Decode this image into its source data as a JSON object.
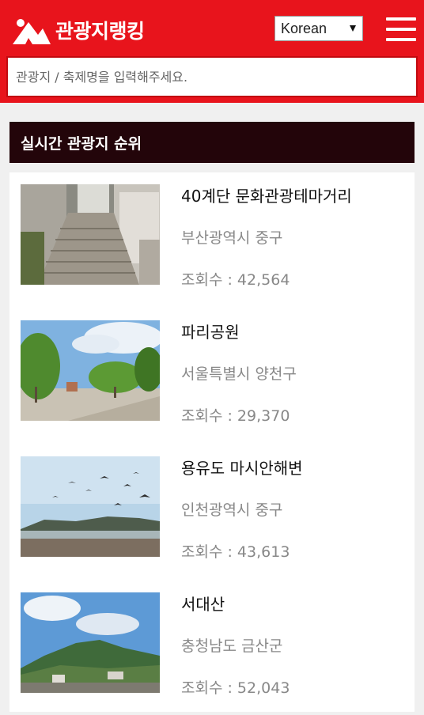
{
  "header": {
    "site_title": "관광지랭킹",
    "language": "Korean",
    "brand_color": "#e8141c"
  },
  "search": {
    "placeholder": "관광지 / 축제명을 입력해주세요.",
    "value": ""
  },
  "section": {
    "title": "실시간 관광지 순위"
  },
  "items": [
    {
      "title": "40계단 문화관광테마거리",
      "region": "부산광역시 중구",
      "views": "조회수 : 42,564",
      "thumb": "stairs-alley-photo"
    },
    {
      "title": "파리공원",
      "region": "서울특별시 양천구",
      "views": "조회수 : 29,370",
      "thumb": "park-trees-photo"
    },
    {
      "title": "용유도 마시안해변",
      "region": "인천광역시 중구",
      "views": "조회수 : 43,613",
      "thumb": "beach-seagulls-photo"
    },
    {
      "title": "서대산",
      "region": "충청남도 금산군",
      "views": "조회수 : 52,043",
      "thumb": "mountain-town-photo"
    }
  ]
}
